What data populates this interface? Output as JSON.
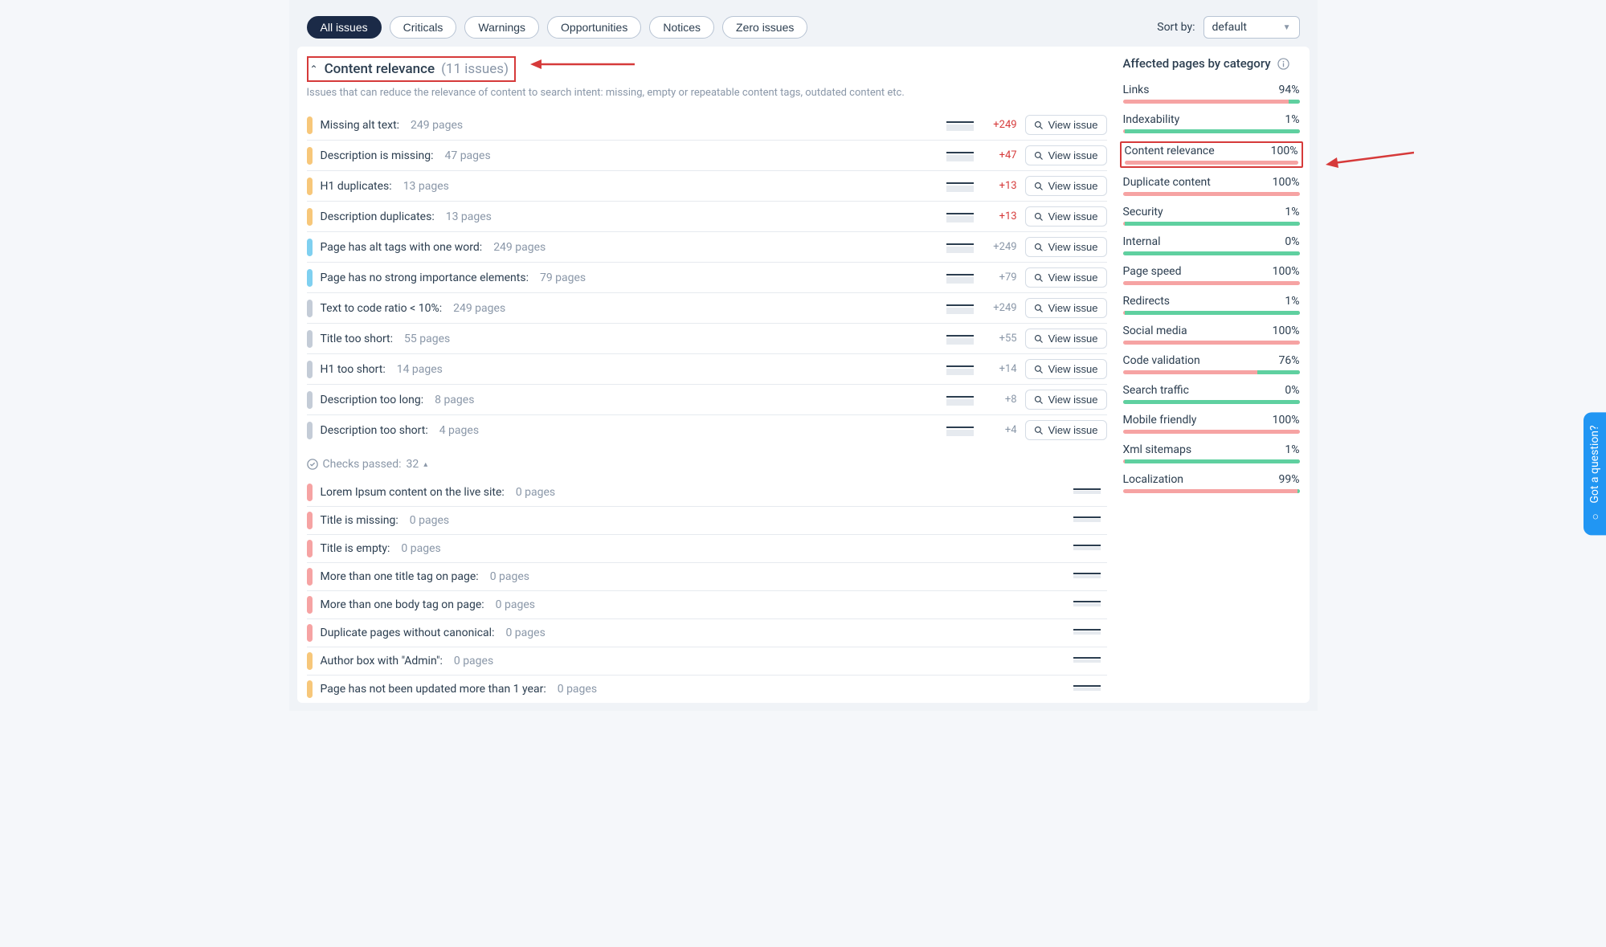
{
  "toolbar": {
    "filters": [
      {
        "label": "All issues",
        "active": true
      },
      {
        "label": "Criticals",
        "active": false
      },
      {
        "label": "Warnings",
        "active": false
      },
      {
        "label": "Opportunities",
        "active": false
      },
      {
        "label": "Notices",
        "active": false
      },
      {
        "label": "Zero issues",
        "active": false
      }
    ],
    "sort_label": "Sort by:",
    "sort_value": "default"
  },
  "section": {
    "title": "Content relevance",
    "count_label": "(11 issues)",
    "description": "Issues that can reduce the relevance of content to search intent: missing, empty or repeatable content tags, outdated content etc."
  },
  "view_issue_label": "View issue",
  "issues": [
    {
      "sev": "orange",
      "name": "Missing alt text",
      "pages": "249 pages",
      "delta": "+249",
      "delta_style": "red",
      "view": true
    },
    {
      "sev": "orange",
      "name": "Description is missing",
      "pages": "47 pages",
      "delta": "+47",
      "delta_style": "red",
      "view": true
    },
    {
      "sev": "orange",
      "name": "H1 duplicates",
      "pages": "13 pages",
      "delta": "+13",
      "delta_style": "red",
      "view": true
    },
    {
      "sev": "orange",
      "name": "Description duplicates",
      "pages": "13 pages",
      "delta": "+13",
      "delta_style": "red",
      "view": true
    },
    {
      "sev": "blue",
      "name": "Page has alt tags with one word",
      "pages": "249 pages",
      "delta": "+249",
      "delta_style": "gray",
      "view": true
    },
    {
      "sev": "blue",
      "name": "Page has no strong importance elements",
      "pages": "79 pages",
      "delta": "+79",
      "delta_style": "gray",
      "view": true
    },
    {
      "sev": "gray",
      "name": "Text to code ratio < 10%",
      "pages": "249 pages",
      "delta": "+249",
      "delta_style": "gray",
      "view": true
    },
    {
      "sev": "gray",
      "name": "Title too short",
      "pages": "55 pages",
      "delta": "+55",
      "delta_style": "gray",
      "view": true
    },
    {
      "sev": "gray",
      "name": "H1 too short",
      "pages": "14 pages",
      "delta": "+14",
      "delta_style": "gray",
      "view": true
    },
    {
      "sev": "gray",
      "name": "Description too long",
      "pages": "8 pages",
      "delta": "+8",
      "delta_style": "gray",
      "view": true
    },
    {
      "sev": "gray",
      "name": "Description too short",
      "pages": "4 pages",
      "delta": "+4",
      "delta_style": "gray",
      "view": true
    }
  ],
  "checks_passed": {
    "label": "Checks passed:",
    "count": "32",
    "caret": "▴"
  },
  "passed": [
    {
      "sev": "red",
      "name": "Lorem Ipsum content on the live site",
      "pages": "0 pages"
    },
    {
      "sev": "red",
      "name": "Title is missing",
      "pages": "0 pages"
    },
    {
      "sev": "red",
      "name": "Title is empty",
      "pages": "0 pages"
    },
    {
      "sev": "red",
      "name": "More than one title tag on page",
      "pages": "0 pages"
    },
    {
      "sev": "red",
      "name": "More than one body tag on page",
      "pages": "0 pages"
    },
    {
      "sev": "red",
      "name": "Duplicate pages without canonical",
      "pages": "0 pages"
    },
    {
      "sev": "orange",
      "name": "Author box with \"Admin\"",
      "pages": "0 pages"
    },
    {
      "sev": "orange",
      "name": "Page has not been updated more than 1 year",
      "pages": "0 pages"
    }
  ],
  "sidebar": {
    "title": "Affected pages by category",
    "categories": [
      {
        "name": "Links",
        "pct": "94%",
        "green": 6
      },
      {
        "name": "Indexability",
        "pct": "1%",
        "green": 99
      },
      {
        "name": "Content relevance",
        "pct": "100%",
        "green": 0,
        "highlight": true
      },
      {
        "name": "Duplicate content",
        "pct": "100%",
        "green": 0
      },
      {
        "name": "Security",
        "pct": "1%",
        "green": 99
      },
      {
        "name": "Internal",
        "pct": "0%",
        "green": 100
      },
      {
        "name": "Page speed",
        "pct": "100%",
        "green": 0
      },
      {
        "name": "Redirects",
        "pct": "1%",
        "green": 99
      },
      {
        "name": "Social media",
        "pct": "100%",
        "green": 0
      },
      {
        "name": "Code validation",
        "pct": "76%",
        "green": 24
      },
      {
        "name": "Search traffic",
        "pct": "0%",
        "green": 100
      },
      {
        "name": "Mobile friendly",
        "pct": "100%",
        "green": 0
      },
      {
        "name": "Xml sitemaps",
        "pct": "1%",
        "green": 99
      },
      {
        "name": "Localization",
        "pct": "99%",
        "green": 1
      }
    ]
  },
  "help_button": "Got a question?"
}
